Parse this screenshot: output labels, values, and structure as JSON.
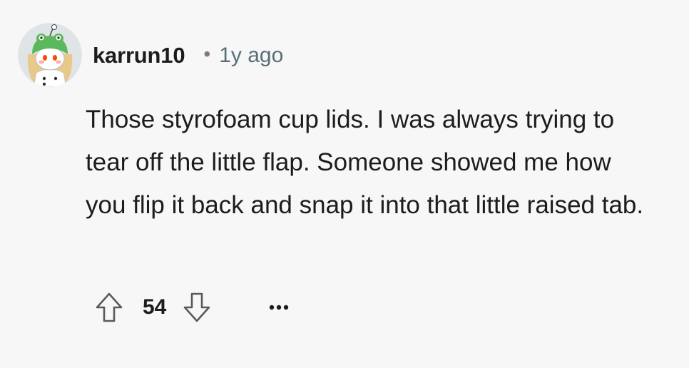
{
  "comment": {
    "author": "karrun10",
    "separator": "•",
    "time_ago": "1y ago",
    "avatar_icon": "snoo-frog-hat-avatar-icon",
    "body": "Those styrofoam cup lids. I was always trying to tear off the little flap. Someone showed me how you flip it back and snap it into that little raised tab.",
    "score": "54",
    "upvote_icon": "upvote-arrow-icon",
    "downvote_icon": "downvote-arrow-icon",
    "more_icon": "more-options-icon"
  },
  "colors": {
    "background": "#f7f7f8",
    "text": "#1c1c1c",
    "meta_text": "#576f76",
    "icon_stroke": "#5a5a5a"
  }
}
